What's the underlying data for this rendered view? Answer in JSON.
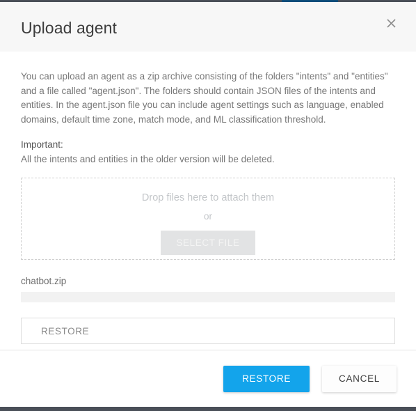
{
  "page_background": {
    "bar_color": "#4a4f58",
    "accent_color": "#0d4d7a"
  },
  "dialog": {
    "title": "Upload agent",
    "close_icon": "close-icon",
    "intro_text": "You can upload an agent as a zip archive consisting of the folders \"intents\" and \"entities\" and a file called \"agent.json\". The folders should contain JSON files of the intents and entities. In the agent.json file you can include agent settings such as language, enabled domains, default time zone, match mode, and ML classification threshold.",
    "important_label": "Important:",
    "important_note": "All the intents and entities in the older version will be deleted.",
    "dropzone": {
      "hint": "Drop files here to attach them",
      "or": "or",
      "select_file_label": "SELECT FILE"
    },
    "upload": {
      "file_name": "chatbot.zip",
      "progress_percent": 0
    },
    "restore_field": {
      "value": "RESTORE",
      "placeholder": "RESTORE"
    },
    "footer": {
      "primary_label": "RESTORE",
      "secondary_label": "CANCEL",
      "primary_color": "#13a4eb"
    }
  }
}
